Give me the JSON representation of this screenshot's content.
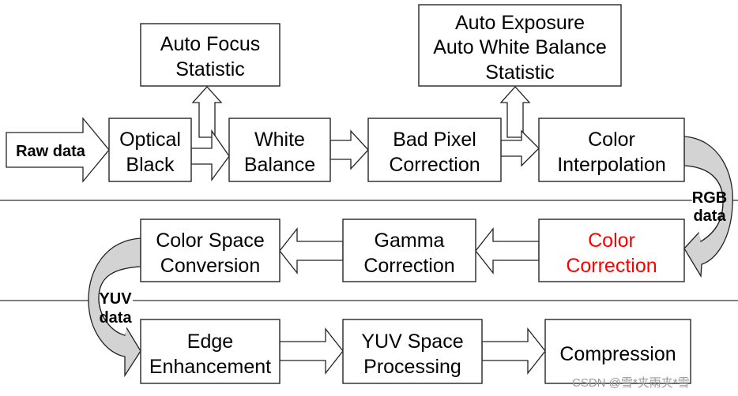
{
  "input_label": "Raw data",
  "top_boxes": [
    {
      "lines": [
        "Auto Focus",
        "Statistic"
      ]
    },
    {
      "lines": [
        "Auto Exposure",
        "Auto White Balance",
        "Statistic"
      ]
    }
  ],
  "row1": [
    {
      "lines": [
        "Optical",
        "Black"
      ]
    },
    {
      "lines": [
        "White",
        "Balance"
      ]
    },
    {
      "lines": [
        "Bad Pixel",
        "Correction"
      ]
    },
    {
      "lines": [
        "Color",
        "Interpolation"
      ]
    }
  ],
  "row2": [
    {
      "lines": [
        "Color",
        "Correction"
      ],
      "color": "#ff0000"
    },
    {
      "lines": [
        "Gamma",
        "Correction"
      ]
    },
    {
      "lines": [
        "Color Space",
        "Conversion"
      ]
    }
  ],
  "row3": [
    {
      "lines": [
        "Edge",
        "Enhancement"
      ]
    },
    {
      "lines": [
        "YUV Space",
        "Processing"
      ]
    },
    {
      "lines": [
        "Compression"
      ]
    }
  ],
  "rgb_label": [
    "RGB",
    "data"
  ],
  "yuv_label": [
    "YUV",
    "data"
  ],
  "watermark": "CSDN @雪*夹雨夹*雪",
  "colors": {
    "highlight": "#ff0000",
    "curve_fill": "#d3d3d3"
  }
}
